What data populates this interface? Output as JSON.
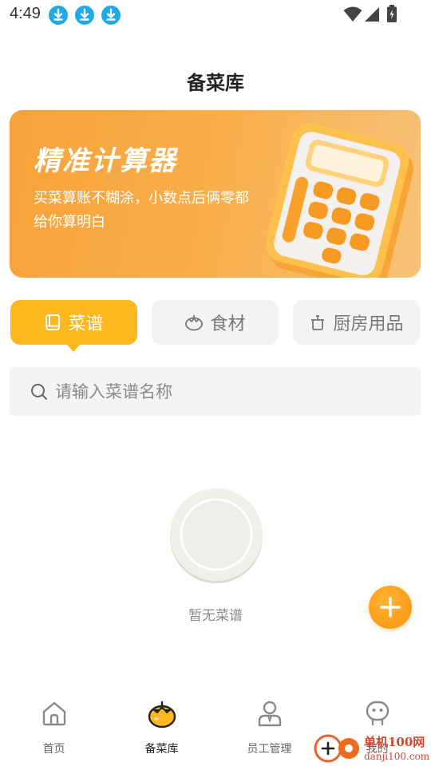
{
  "status_bar": {
    "time": "4:49"
  },
  "page": {
    "title": "备菜库"
  },
  "banner": {
    "title": "精准计算器",
    "subtitle": "买菜算账不糊涂，小数点后俩零都给你算明白"
  },
  "tabs": [
    {
      "label": "菜谱",
      "icon": "book-icon",
      "active": true
    },
    {
      "label": "食材",
      "icon": "tomato-icon",
      "active": false
    },
    {
      "label": "厨房用品",
      "icon": "pot-icon",
      "active": false
    }
  ],
  "search": {
    "placeholder": "请输入菜谱名称",
    "value": ""
  },
  "empty_state": {
    "text": "暂无菜谱"
  },
  "bottom_nav": [
    {
      "label": "首页",
      "icon": "home-icon",
      "active": false
    },
    {
      "label": "备菜库",
      "icon": "tomato-icon",
      "active": true
    },
    {
      "label": "员工管理",
      "icon": "staff-icon",
      "active": false
    },
    {
      "label": "我的",
      "icon": "profile-icon",
      "active": false
    }
  ],
  "watermark": {
    "text": "单机100网",
    "sub": "danji100.com"
  },
  "colors": {
    "accent": "#fcb81d",
    "banner": "#f7a23a",
    "fab": "#f7940c",
    "download_badge": "#1fa9e6"
  }
}
